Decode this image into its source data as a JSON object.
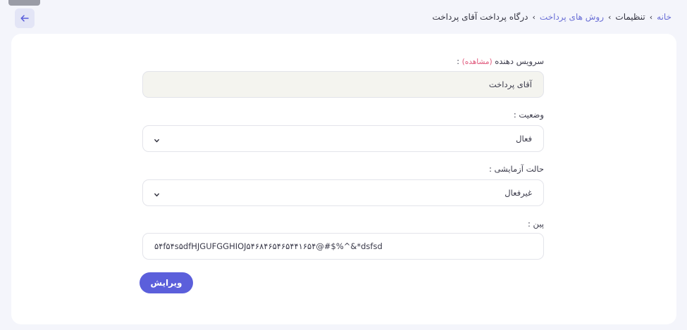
{
  "breadcrumb": {
    "items": [
      {
        "label": "خانه",
        "link": true
      },
      {
        "label": "تنظیمات",
        "link": false
      },
      {
        "label": "روش های پرداخت",
        "link": true
      },
      {
        "label": "درگاه پرداخت آقای پرداخت",
        "link": false
      }
    ],
    "separator": "›"
  },
  "back_button": {
    "icon": "arrow-left-icon"
  },
  "form": {
    "provider": {
      "label": "سرویس دهنده",
      "hint": "(مشاهده)",
      "suffix": " :",
      "value": "آقای پرداخت"
    },
    "status": {
      "label": "وضعیت :",
      "value": "فعال"
    },
    "test_mode": {
      "label": "حالت آزمایشی :",
      "value": "غیرفعال"
    },
    "pin": {
      "label": "پین :",
      "value": "۵۴f۵۴s۵dfHJGUFGGHIOJ۵۴۶۸۴۶۵۴۶۵۴۴۱۶۵۴@#$%^&*dsfsd"
    },
    "submit_label": "ویرایش"
  },
  "colors": {
    "accent": "#5b5fdb",
    "link": "#6a6fd6",
    "hint": "#e0577b",
    "background": "#f4f5fb"
  }
}
